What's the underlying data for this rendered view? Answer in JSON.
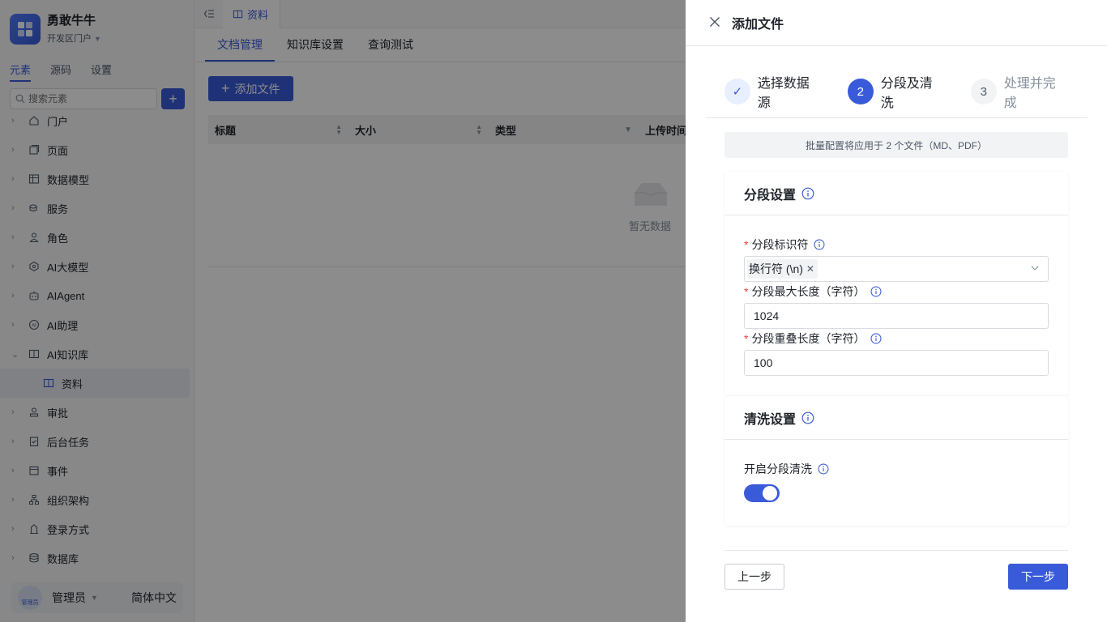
{
  "colors": {
    "accent": "#3a5bd9",
    "required": "#f53f3f",
    "mask": "rgba(0,0,0,0.45)"
  },
  "brand": {
    "name": "勇敢牛牛",
    "subtitle": "开发区门户"
  },
  "sidebar": {
    "tabs": [
      {
        "label": "元素",
        "active": true
      },
      {
        "label": "源码",
        "active": false
      },
      {
        "label": "设置",
        "active": false
      }
    ],
    "search_placeholder": "搜索元素",
    "items": [
      {
        "label": "门户",
        "icon": "home-icon"
      },
      {
        "label": "页面",
        "icon": "pages-icon"
      },
      {
        "label": "数据模型",
        "icon": "table-icon"
      },
      {
        "label": "服务",
        "icon": "service-icon"
      },
      {
        "label": "角色",
        "icon": "role-icon"
      },
      {
        "label": "AI大模型",
        "icon": "ai-model-icon"
      },
      {
        "label": "AIAgent",
        "icon": "robot-icon"
      },
      {
        "label": "AI助理",
        "icon": "ai-assistant-icon"
      },
      {
        "label": "AI知识库",
        "icon": "book-icon",
        "expanded": true
      },
      {
        "label": "资料",
        "icon": "book-icon",
        "child": true,
        "selected": true
      },
      {
        "label": "审批",
        "icon": "approval-icon"
      },
      {
        "label": "后台任务",
        "icon": "task-icon"
      },
      {
        "label": "事件",
        "icon": "event-icon"
      },
      {
        "label": "组织架构",
        "icon": "org-icon"
      },
      {
        "label": "登录方式",
        "icon": "login-icon"
      },
      {
        "label": "数据库",
        "icon": "database-icon"
      }
    ],
    "footer": {
      "avatar_text": "管理员",
      "user_name": "管理员",
      "language": "简体中文"
    }
  },
  "main": {
    "page_tab": "资料",
    "subtabs": [
      {
        "label": "文档管理",
        "active": true
      },
      {
        "label": "知识库设置",
        "active": false
      },
      {
        "label": "查询测试",
        "active": false
      }
    ],
    "add_file_label": "添加文件",
    "table": {
      "columns": [
        "标题",
        "大小",
        "类型",
        "上传时间"
      ],
      "empty_text": "暂无数据"
    }
  },
  "drawer": {
    "title": "添加文件",
    "steps": [
      {
        "index": "1",
        "label": "选择数据源",
        "status": "done"
      },
      {
        "index": "2",
        "label": "分段及清洗",
        "status": "active"
      },
      {
        "index": "3",
        "label": "处理并完成",
        "status": "wait"
      }
    ],
    "notice": "批量配置将应用于 2 个文件（MD、PDF）",
    "segment": {
      "title": "分段设置",
      "separator_label": "分段标识符",
      "separator_tag": "换行符 (\\n)",
      "max_length_label": "分段最大长度（字符）",
      "max_length_value": "1024",
      "overlap_label": "分段重叠长度（字符）",
      "overlap_value": "100"
    },
    "cleaning": {
      "title": "清洗设置",
      "toggle_label": "开启分段清洗",
      "enabled": true
    },
    "prev_label": "上一步",
    "next_label": "下一步"
  }
}
